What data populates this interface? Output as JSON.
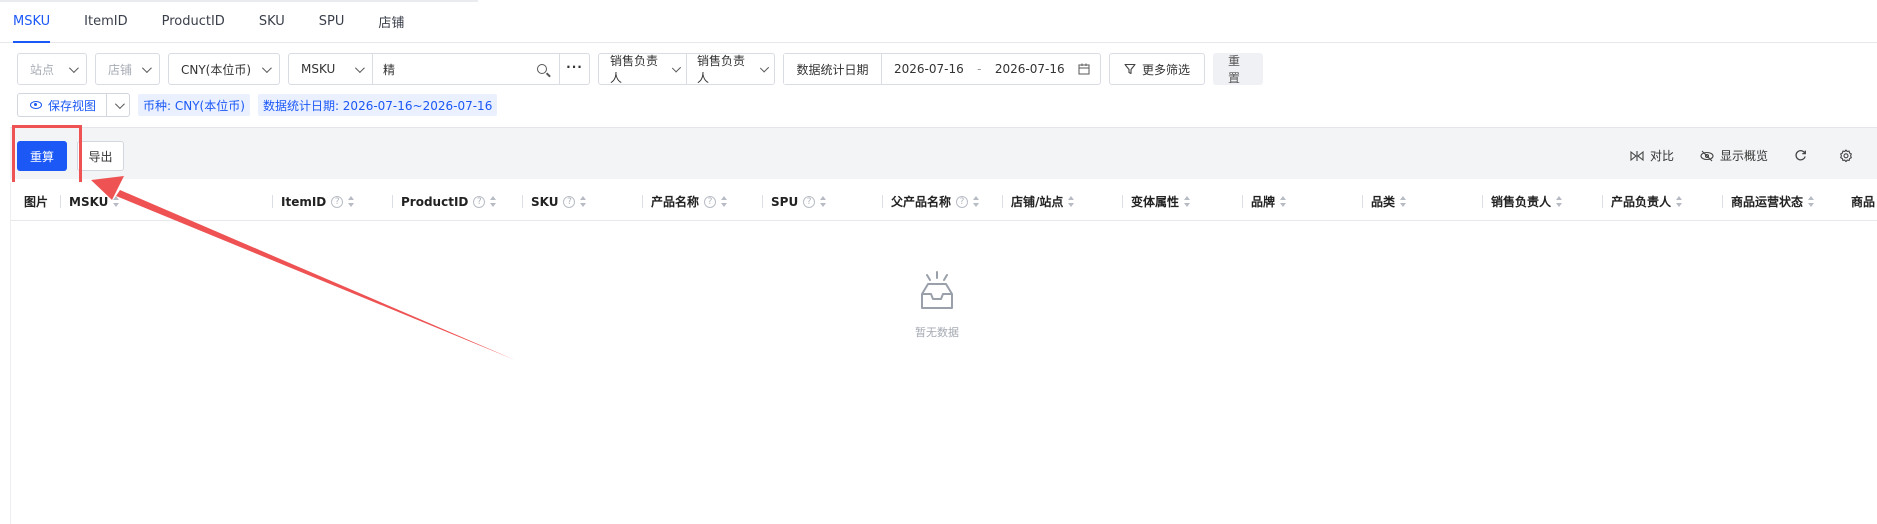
{
  "tabs": [
    "MSKU",
    "ItemID",
    "ProductID",
    "SKU",
    "SPU",
    "店铺"
  ],
  "filters": {
    "site_placeholder": "站点",
    "shop_placeholder": "店铺",
    "currency_value": "CNY(本位币)",
    "search_type": "MSKU",
    "search_value": "精",
    "sales_owner_type": "销售负责人",
    "sales_owner_placeholder": "销售负责人",
    "date_label": "数据统计日期",
    "date_start": "2026-07-16",
    "date_sep": "-",
    "date_end": "2026-07-16",
    "more_filters": "更多筛选",
    "reset": "重置"
  },
  "tagrow": {
    "save_view": "保存视图",
    "tag_currency": "币种: CNY(本位币)",
    "tag_date": "数据统计日期: 2026-07-16~2026-07-16"
  },
  "toolbar": {
    "recalc": "重算",
    "export": "导出",
    "compare": "对比",
    "show_overview": "显示概览"
  },
  "columns": [
    "图片",
    "MSKU",
    "ItemID",
    "ProductID",
    "SKU",
    "产品名称",
    "SPU",
    "父产品名称",
    "店铺/站点",
    "变体属性",
    "品牌",
    "品类",
    "销售负责人",
    "产品负责人",
    "商品运营状态",
    "商品"
  ],
  "empty_text": "暂无数据",
  "colors": {
    "primary": "#1b58f5",
    "annotation": "#ee5253"
  }
}
